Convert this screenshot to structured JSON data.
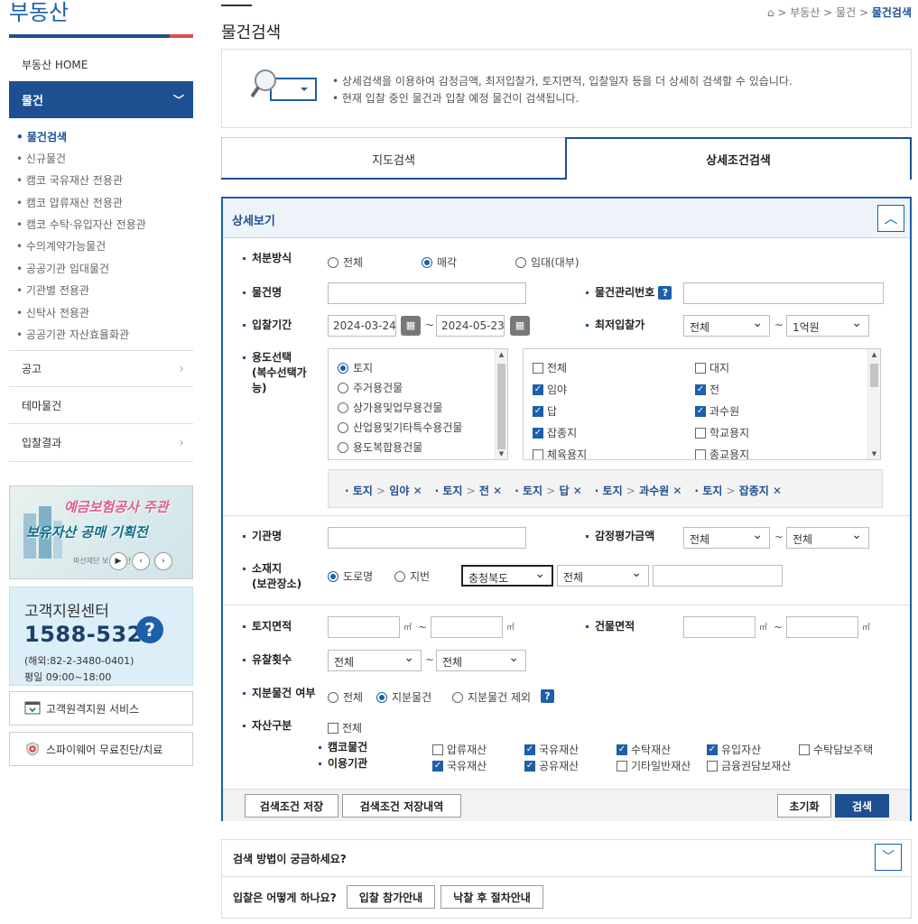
{
  "sidebar": {
    "title": "부동산",
    "nav_home": "부동산 HOME",
    "nav_active": "물건",
    "sub": [
      "물건검색",
      "신규물건",
      "캠코 국유재산 전용관",
      "캠코 압류재산 전용관",
      "캠코 수탁·유입자산 전용관",
      "수의계약가능물건",
      "공공기관 임대물건",
      "기관별 전용관",
      "신탁사 전용관",
      "공공기관 자산효율화관"
    ],
    "nav_notice": "공고",
    "nav_theme": "테마물건",
    "nav_result": "입찰결과",
    "banner": {
      "line1": "예금보험공사 주관",
      "line2": "보유자산 공매 기획전",
      "small": "파산재단 보유 자산 매각"
    },
    "cs": {
      "title": "고객지원센터",
      "tel": "1588-5321",
      "overseas": "(해외:82-2-3480-0401)",
      "hours": "평일 09:00~18:00"
    },
    "svc1": "고객원격지원 서비스",
    "svc2": "스파이웨어 무료진단/치료"
  },
  "header": {
    "title": "물건검색",
    "crumb": [
      "부동산",
      "물건",
      "물건검색"
    ]
  },
  "info": {
    "line1": "• 상세검색을 이용하여 감정금액, 최저입찰가, 토지면적, 입찰일자 등을 더 상세히 검색할 수 있습니다.",
    "line2": "• 현재 입찰 중인 물건과 입찰 예정 물건이 검색됩니다."
  },
  "tabs": {
    "map": "지도검색",
    "detail": "상세조건검색"
  },
  "form": {
    "head": "상세보기",
    "dispose": {
      "label": "처분방식",
      "opts": [
        "전체",
        "매각",
        "임대(대부)"
      ],
      "selected": "매각"
    },
    "name": {
      "label": "물건명",
      "value": ""
    },
    "mgmt": {
      "label": "물건관리번호",
      "value": ""
    },
    "period": {
      "label": "입찰기간",
      "from": "2024-03-24",
      "to": "2024-05-23"
    },
    "minbid": {
      "label": "최저입찰가",
      "from": "전체",
      "to": "1억원"
    },
    "usage": {
      "label1": "용도선택",
      "label2": "(복수선택가",
      "label3": "능)",
      "left": [
        "토지",
        "주거용건물",
        "상가용및업무용건물",
        "산업용및기타특수용건물",
        "용도복합용건물"
      ],
      "left_selected": "토지",
      "right": [
        {
          "l": "전체",
          "c": false
        },
        {
          "l": "대지",
          "c": false
        },
        {
          "l": "임야",
          "c": true
        },
        {
          "l": "전",
          "c": true
        },
        {
          "l": "답",
          "c": true
        },
        {
          "l": "과수원",
          "c": true
        },
        {
          "l": "잡종지",
          "c": true
        },
        {
          "l": "학교용지",
          "c": false
        },
        {
          "l": "체육용지",
          "c": false
        },
        {
          "l": "종교용지",
          "c": false
        }
      ]
    },
    "tags": [
      {
        "cat": "토지",
        "item": "임야"
      },
      {
        "cat": "토지",
        "item": "전"
      },
      {
        "cat": "토지",
        "item": "답"
      },
      {
        "cat": "토지",
        "item": "과수원"
      },
      {
        "cat": "토지",
        "item": "잡종지"
      }
    ],
    "agency": {
      "label": "기관명",
      "value": ""
    },
    "appraisal": {
      "label": "감정평가금액",
      "from": "전체",
      "to": "전체"
    },
    "location": {
      "label1": "소재지",
      "label2": "(보관장소)",
      "opts": [
        "도로명",
        "지번"
      ],
      "selected": "도로명",
      "sido": "충청북도",
      "sigungu": "전체",
      "detail": ""
    },
    "land": {
      "label": "토지면적",
      "unit": "㎡"
    },
    "bldg": {
      "label": "건물면적",
      "unit": "㎡"
    },
    "fail": {
      "label": "유찰횟수",
      "from": "전체",
      "to": "전체"
    },
    "share": {
      "label": "지분물건 여부",
      "opts": [
        "전체",
        "지분물건",
        "지분물건 제외"
      ],
      "selected": "지분물건"
    },
    "asset": {
      "label": "자산구분",
      "all": "전체",
      "row1": "캠코물건",
      "row2": "이용기관",
      "r1": [
        {
          "l": "압류재산",
          "c": false
        },
        {
          "l": "국유재산",
          "c": true
        },
        {
          "l": "수탁재산",
          "c": true
        },
        {
          "l": "유입자산",
          "c": true
        },
        {
          "l": "수탁담보주택",
          "c": false
        }
      ],
      "r2": [
        {
          "l": "국유재산",
          "c": true
        },
        {
          "l": "공유재산",
          "c": true
        },
        {
          "l": "기타일반재산",
          "c": false
        },
        {
          "l": "금융권담보재산",
          "c": false
        }
      ]
    },
    "btn_save": "검색조건 저장",
    "btn_saved": "검색조건 저장내역",
    "btn_reset": "초기화",
    "btn_search": "검색"
  },
  "help": {
    "q": "검색 방법이 궁금하세요?",
    "q2": "입찰은 어떻게 하나요?",
    "b1": "입찰 참가안내",
    "b2": "낙찰 후 절차안내"
  }
}
